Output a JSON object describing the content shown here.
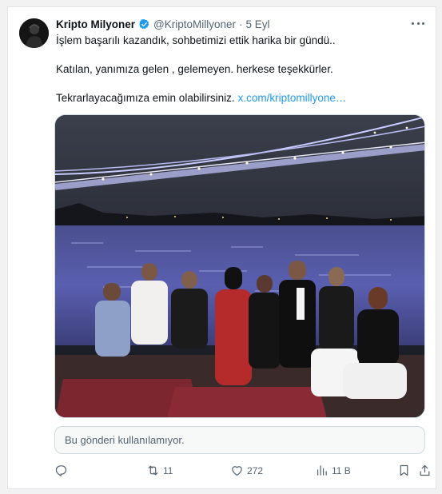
{
  "tweet": {
    "display_name": "Kripto Milyoner",
    "handle": "@KriptoMillyoner",
    "separator": "·",
    "date": "5 Eyl",
    "lines": [
      "İşlem başarılı kazandık, sohbetimizi ettik harika bir gündü..",
      "Katılan, yanımıza gelen , gelemeyen. herkese teşekkürler.",
      "Tekrarlayacağımıza emin olabilirsiniz."
    ],
    "link": "x.com/kriptomillyone…",
    "unavailable_notice": "Bu gönderi kullanılamıyor."
  },
  "actions": {
    "reply_count": "",
    "retweet_count": "11",
    "like_count": "272",
    "views_count": "11 B"
  },
  "colors": {
    "accent": "#1d9bf0",
    "verified_badge": "#1d9bf0",
    "muted_text": "#536471"
  },
  "icons": [
    "avatar",
    "verified-badge-icon",
    "more-icon",
    "reply-icon",
    "retweet-icon",
    "like-icon",
    "views-icon",
    "bookmark-icon",
    "share-icon"
  ]
}
